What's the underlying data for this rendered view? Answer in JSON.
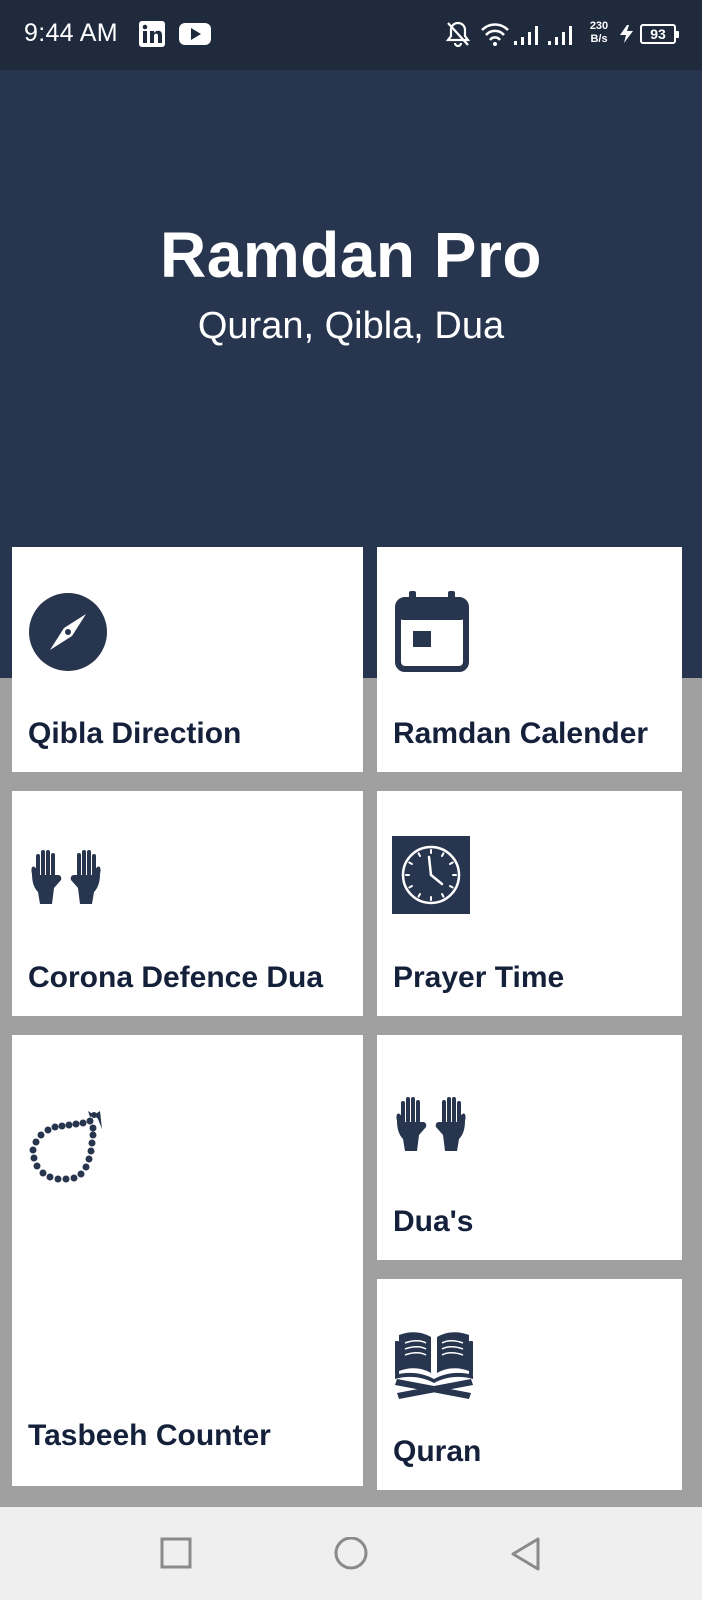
{
  "status_bar": {
    "time": "9:44 AM",
    "notification_icons": [
      "linkedin-icon",
      "youtube-icon"
    ],
    "system_icons": [
      "mute-bell-icon",
      "wifi-icon",
      "signal-icon",
      "signal-icon",
      "charging-icon"
    ],
    "net_speed_value": "230",
    "net_speed_unit": "B/s",
    "battery_level": "93"
  },
  "header": {
    "title": "Ramdan Pro",
    "subtitle": "Quran, Qibla, Dua",
    "background_color": "#28354f"
  },
  "menu": {
    "qibla": {
      "label": "Qibla Direction",
      "icon": "compass-icon"
    },
    "calendar": {
      "label": "Ramdan Calender",
      "icon": "calendar-icon"
    },
    "corona_dua": {
      "label": "Corona Defence Dua",
      "icon": "praying-hands-icon"
    },
    "prayer_time": {
      "label": "Prayer Time",
      "icon": "clock-icon"
    },
    "tasbeeh": {
      "label": "Tasbeeh Counter",
      "icon": "prayer-beads-icon"
    },
    "duas": {
      "label": "Dua's",
      "icon": "praying-hands-icon"
    },
    "quran": {
      "label": "Quran",
      "icon": "open-book-icon"
    }
  },
  "nav_bar": {
    "buttons": [
      "recent-apps-icon",
      "home-icon",
      "back-icon"
    ]
  },
  "colors": {
    "accent": "#28354f",
    "grid_background": "#a0a0a0",
    "card_background": "#ffffff",
    "label_text": "#15213b"
  }
}
